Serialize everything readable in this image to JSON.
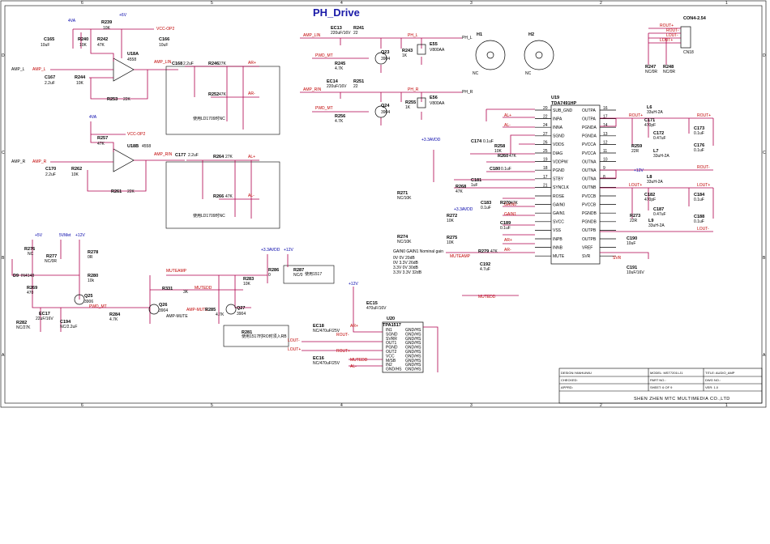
{
  "title": "PH_Drive",
  "frame": {
    "cols": [
      "6",
      "5",
      "4",
      "3",
      "2",
      "1"
    ],
    "rows": [
      "D",
      "C",
      "B",
      "A"
    ]
  },
  "title_block": {
    "design": "DESIGN:YANHUIWU",
    "checked": "CHECKED:",
    "apprd": "APPRD:",
    "model": "MODEL: MST7201I-J1",
    "part": "PART NO.:",
    "sheet": "SHEET:   6  OF  9",
    "title_field": "TITLE: AUDIO_AMP",
    "dwg": "DWG NO.:",
    "ver": "VER: 1.0",
    "company": "SHEN ZHEN MTC MULTIMEDIA CO.,LTD"
  },
  "nets": {
    "amp_l": "AMP_L",
    "amp_r": "AMP_R",
    "vcc_op2": "VCC-OP2",
    "amp_lin": "AMP_LIN",
    "amp_rin": "AMP_RIN",
    "pwd_mt": "PWD_MT",
    "ph_l": "PH_L",
    "ph_r": "PH_R",
    "ar_p": "AR+",
    "ar_m": "AR-",
    "al_p": "AL+",
    "al_m": "AL-",
    "v33": "+3.3AVDD",
    "v12": "+12V",
    "v5": "+5V",
    "v4": "4VA",
    "v6": "+6V",
    "mutamp": "MUTEAMP",
    "mutedd": "MUTEDD",
    "ampmute": "AMP-MUTE",
    "rout_p": "ROUT+",
    "rout_m": "ROUT-",
    "lout_p": "LOUT+",
    "lout_m": "LOUT-",
    "gain0": "GAIN0",
    "gain1": "GAIN1",
    "svmet": "5VMet",
    "svr": "SVR"
  },
  "parts": {
    "u18a": "U18A",
    "u18a_val": "4558",
    "u18b": "U18B",
    "u18b_val": "4558",
    "u19": "U19",
    "u19_val": "TDA7491HP",
    "u20": "U20",
    "u20_val": "TPA1517",
    "con": "CON4-2.54",
    "cn": "CN18",
    "h1": "H1",
    "h2": "H2",
    "nc": "NC",
    "q23": "Q23",
    "q23_val": "3904",
    "q24": "Q24",
    "q24_val": "3904",
    "q25": "Q25",
    "q25_val": "3906",
    "q26": "Q26",
    "q26_val": "3904",
    "q27": "Q27",
    "q27_val": "3904",
    "e55": "E55",
    "e55_val": "V800AA",
    "e56": "E56",
    "e56_val": "V800AA",
    "d9": "D9",
    "d9_val": "IN4148"
  },
  "u19_left_pins": [
    {
      "num": "20",
      "name": "SUB_GND"
    },
    {
      "num": "22",
      "name": "INPA"
    },
    {
      "num": "24",
      "name": "INNA"
    },
    {
      "num": "27",
      "name": "SGND"
    },
    {
      "num": "26",
      "name": "VDDS"
    },
    {
      "num": "25",
      "name": "DIAG"
    },
    {
      "num": "19",
      "name": "VDDPW"
    },
    {
      "num": "18",
      "name": "PGND"
    },
    {
      "num": "17",
      "name": "STBY"
    },
    {
      "num": "21",
      "name": "SYNCLK"
    },
    {
      "num": "",
      "name": "ROSE"
    },
    {
      "num": "",
      "name": "GAIN0"
    },
    {
      "num": "",
      "name": "GAIN1"
    },
    {
      "num": "",
      "name": "SVCC"
    },
    {
      "num": "",
      "name": "VSS"
    },
    {
      "num": "",
      "name": "INPB"
    },
    {
      "num": "",
      "name": "INNB"
    },
    {
      "num": "",
      "name": "MUTE"
    }
  ],
  "u19_right_pins": [
    {
      "num": "16",
      "name": "OUTPA"
    },
    {
      "num": "17",
      "name": "OUTPA"
    },
    {
      "num": "14",
      "name": "PGNDA"
    },
    {
      "num": "13",
      "name": "PGNDA"
    },
    {
      "num": "12",
      "name": "PVCCA"
    },
    {
      "num": "11",
      "name": "PVCCA"
    },
    {
      "num": "10",
      "name": "OUTNA"
    },
    {
      "num": "9",
      "name": "OUTNA"
    },
    {
      "num": "8",
      "name": "OUTNA"
    },
    {
      "num": "",
      "name": "OUTNB"
    },
    {
      "num": "",
      "name": "PVCCB"
    },
    {
      "num": "",
      "name": "PVCCB"
    },
    {
      "num": "",
      "name": "PGNDB"
    },
    {
      "num": "",
      "name": "PGNDB"
    },
    {
      "num": "",
      "name": "OUTPB"
    },
    {
      "num": "",
      "name": "OUTPB"
    },
    {
      "num": "",
      "name": "VREF"
    },
    {
      "num": "",
      "name": "SVR"
    }
  ],
  "u20_pins": [
    {
      "l": "IN1",
      "r": "GND/HS"
    },
    {
      "l": "SGND",
      "r": "GND/HS"
    },
    {
      "l": "SVRR",
      "r": "GND/HS"
    },
    {
      "l": "OUT1",
      "r": "GND/HS"
    },
    {
      "l": "PGND",
      "r": "GND/HS"
    },
    {
      "l": "OUT2",
      "r": "GND/HS"
    },
    {
      "l": "VCC",
      "r": "GND/HS"
    },
    {
      "l": "M/SB",
      "r": "GND/HS"
    },
    {
      "l": "IN2",
      "r": "GND/HS"
    },
    {
      "l": "GND/HS",
      "r": "GND/HS"
    }
  ],
  "labels": [
    {
      "id": "c165",
      "t": "C165"
    },
    {
      "id": "c165v",
      "t": "10uF"
    },
    {
      "id": "r240",
      "t": "R240"
    },
    {
      "id": "r240v",
      "t": "10K"
    },
    {
      "id": "r239",
      "t": "R239"
    },
    {
      "id": "r239v",
      "t": "10K"
    },
    {
      "id": "r242",
      "t": "R242"
    },
    {
      "id": "r242v",
      "t": "47K"
    },
    {
      "id": "c166",
      "t": "C166"
    },
    {
      "id": "c166v",
      "t": "10uF"
    },
    {
      "id": "c167",
      "t": "C167"
    },
    {
      "id": "c167v",
      "t": "2.2uF"
    },
    {
      "id": "r244",
      "t": "R244"
    },
    {
      "id": "r244v",
      "t": "10K"
    },
    {
      "id": "r253",
      "t": "R253"
    },
    {
      "id": "r253v",
      "t": "22K"
    },
    {
      "id": "c168",
      "t": "C168"
    },
    {
      "id": "c168v",
      "t": "2.2uF"
    },
    {
      "id": "r246",
      "t": "R246"
    },
    {
      "id": "r246v",
      "t": "27K"
    },
    {
      "id": "r252",
      "t": "R252"
    },
    {
      "id": "r252v",
      "t": "47K"
    },
    {
      "id": "r257",
      "t": "R257"
    },
    {
      "id": "r257v",
      "t": "47K"
    },
    {
      "id": "c170",
      "t": "C170"
    },
    {
      "id": "c170v",
      "t": "2.2uF"
    },
    {
      "id": "r262",
      "t": "R262"
    },
    {
      "id": "r262v",
      "t": "10K"
    },
    {
      "id": "r261",
      "t": "R261"
    },
    {
      "id": "r261v",
      "t": "22K"
    },
    {
      "id": "c177",
      "t": "C177"
    },
    {
      "id": "c177v",
      "t": "2.2uF"
    },
    {
      "id": "r264",
      "t": "R264"
    },
    {
      "id": "r264v",
      "t": "27K"
    },
    {
      "id": "r266",
      "t": "R266"
    },
    {
      "id": "r266v",
      "t": "47K"
    },
    {
      "id": "ec13",
      "t": "EC13"
    },
    {
      "id": "ec13v",
      "t": "220uF/16V"
    },
    {
      "id": "r241",
      "t": "R241"
    },
    {
      "id": "r241v",
      "t": "22"
    },
    {
      "id": "r243",
      "t": "R243"
    },
    {
      "id": "r243v",
      "t": "1K"
    },
    {
      "id": "r245",
      "t": "R245"
    },
    {
      "id": "r245v",
      "t": "4.7K"
    },
    {
      "id": "ec14",
      "t": "EC14"
    },
    {
      "id": "ec14v",
      "t": "220uF/16V"
    },
    {
      "id": "r251",
      "t": "R251"
    },
    {
      "id": "r251v",
      "t": "22"
    },
    {
      "id": "r255",
      "t": "R255"
    },
    {
      "id": "r255v",
      "t": "1K"
    },
    {
      "id": "r256",
      "t": "R256"
    },
    {
      "id": "r256v",
      "t": "4.7K"
    },
    {
      "id": "c174",
      "t": "C174"
    },
    {
      "id": "c174v",
      "t": "0.1uF"
    },
    {
      "id": "r258",
      "t": "R258"
    },
    {
      "id": "r258v",
      "t": "10K"
    },
    {
      "id": "r260",
      "t": "R260"
    },
    {
      "id": "r260v",
      "t": "47K"
    },
    {
      "id": "c180",
      "t": "C180"
    },
    {
      "id": "c180v",
      "t": "0.1uF"
    },
    {
      "id": "c181",
      "t": "C181"
    },
    {
      "id": "c181v",
      "t": "1uF"
    },
    {
      "id": "r268",
      "t": "R268"
    },
    {
      "id": "r268v",
      "t": "47K"
    },
    {
      "id": "c183",
      "t": "C183"
    },
    {
      "id": "c183v",
      "t": "0.1uF"
    },
    {
      "id": "r270",
      "t": "R270"
    },
    {
      "id": "r270v",
      "t": "47K"
    },
    {
      "id": "c189",
      "t": "C189"
    },
    {
      "id": "c189v",
      "t": "0.1uF"
    },
    {
      "id": "r271",
      "t": "R271"
    },
    {
      "id": "r271v",
      "t": "NC/10K"
    },
    {
      "id": "r272",
      "t": "R272"
    },
    {
      "id": "r272v",
      "t": "10K"
    },
    {
      "id": "r274",
      "t": "R274"
    },
    {
      "id": "r274v",
      "t": "NC/10K"
    },
    {
      "id": "r275",
      "t": "R275"
    },
    {
      "id": "r275v",
      "t": "10K"
    },
    {
      "id": "r279",
      "t": "R279"
    },
    {
      "id": "r279v",
      "t": "47K"
    },
    {
      "id": "c192",
      "t": "C192"
    },
    {
      "id": "c192v",
      "t": "4.7uF"
    },
    {
      "id": "l6",
      "t": "L6"
    },
    {
      "id": "l6v",
      "t": "33uH-2A"
    },
    {
      "id": "c171",
      "t": "C171"
    },
    {
      "id": "c171v",
      "t": "470pF"
    },
    {
      "id": "c172",
      "t": "C172"
    },
    {
      "id": "c172v",
      "t": "0.47uF"
    },
    {
      "id": "c173",
      "t": "C173"
    },
    {
      "id": "c173v",
      "t": "0.1uF"
    },
    {
      "id": "c176",
      "t": "C176"
    },
    {
      "id": "c176v",
      "t": "0.1uF"
    },
    {
      "id": "r259",
      "t": "R259"
    },
    {
      "id": "r259v",
      "t": "22R"
    },
    {
      "id": "l7",
      "t": "L7"
    },
    {
      "id": "l7v",
      "t": "33uH-2A"
    },
    {
      "id": "l8",
      "t": "L8"
    },
    {
      "id": "l8v",
      "t": "33uH-2A"
    },
    {
      "id": "c182",
      "t": "C182"
    },
    {
      "id": "c182v",
      "t": "470pF"
    },
    {
      "id": "c187",
      "t": "C187"
    },
    {
      "id": "c187v",
      "t": "0.47uF"
    },
    {
      "id": "c184",
      "t": "C184"
    },
    {
      "id": "c184v",
      "t": "0.1uF"
    },
    {
      "id": "c188",
      "t": "C188"
    },
    {
      "id": "c188v",
      "t": "0.1uF"
    },
    {
      "id": "r273",
      "t": "R273"
    },
    {
      "id": "r273v",
      "t": "22R"
    },
    {
      "id": "l9",
      "t": "L9"
    },
    {
      "id": "l9v",
      "t": "33uH-2A"
    },
    {
      "id": "c190",
      "t": "C190"
    },
    {
      "id": "c190v",
      "t": "10uF"
    },
    {
      "id": "c191",
      "t": "C191"
    },
    {
      "id": "c191v",
      "t": "10uF/16V"
    },
    {
      "id": "r247",
      "t": "R247"
    },
    {
      "id": "r247v",
      "t": "NC/0R"
    },
    {
      "id": "r248",
      "t": "R248"
    },
    {
      "id": "r248v",
      "t": "NC/0R"
    },
    {
      "id": "r276",
      "t": "R276"
    },
    {
      "id": "r276v",
      "t": "NC"
    },
    {
      "id": "r277",
      "t": "R277"
    },
    {
      "id": "r277v",
      "t": "NC/0R"
    },
    {
      "id": "r278",
      "t": "R278"
    },
    {
      "id": "r278v",
      "t": "0R"
    },
    {
      "id": "r280",
      "t": "R280"
    },
    {
      "id": "r280v",
      "t": "10k"
    },
    {
      "id": "r269",
      "t": "R269"
    },
    {
      "id": "r269v",
      "t": "470"
    },
    {
      "id": "ec17",
      "t": "EC17"
    },
    {
      "id": "ec17v",
      "t": "22uF/16V"
    },
    {
      "id": "c194",
      "t": "C194"
    },
    {
      "id": "c194v",
      "t": "NC/2.2uF"
    },
    {
      "id": "r282",
      "t": "R282"
    },
    {
      "id": "r282v",
      "t": "NC/27K"
    },
    {
      "id": "r284",
      "t": "R284"
    },
    {
      "id": "r284v",
      "t": "4.7K"
    },
    {
      "id": "r331",
      "t": "R331"
    },
    {
      "id": "r331v",
      "t": "3K"
    },
    {
      "id": "r283",
      "t": "R283"
    },
    {
      "id": "r283v",
      "t": "10K"
    },
    {
      "id": "r286",
      "t": "R286"
    },
    {
      "id": "r286v",
      "t": "0"
    },
    {
      "id": "r287",
      "t": "R287"
    },
    {
      "id": "r287v",
      "t": "NC/0"
    },
    {
      "id": "r285",
      "t": "R285"
    },
    {
      "id": "r285v",
      "t": "4.7K"
    },
    {
      "id": "r281",
      "t": "R281"
    },
    {
      "id": "ec15",
      "t": "EC15"
    },
    {
      "id": "ec15v",
      "t": "470uF/16V"
    },
    {
      "id": "ec16",
      "t": "EC16"
    },
    {
      "id": "ec16v",
      "t": "NC/470uF/25V"
    },
    {
      "id": "ec18",
      "t": "EC18"
    },
    {
      "id": "ec18v",
      "t": "NC/470uF/25V"
    }
  ],
  "notes": {
    "box1": "使用LD1709时NC",
    "box2": "使用LD1709时NC",
    "box3": "使用1517",
    "box4": "使用1517时RO时须入RB",
    "table_head": "GAIN0  GAIN1  Nominal gain",
    "table_rows": [
      "0V  0V   20dB",
      "0V  3.3V  26dB",
      "3.3V  0V  30dB",
      "3.3V 3.3V  32dB"
    ]
  }
}
